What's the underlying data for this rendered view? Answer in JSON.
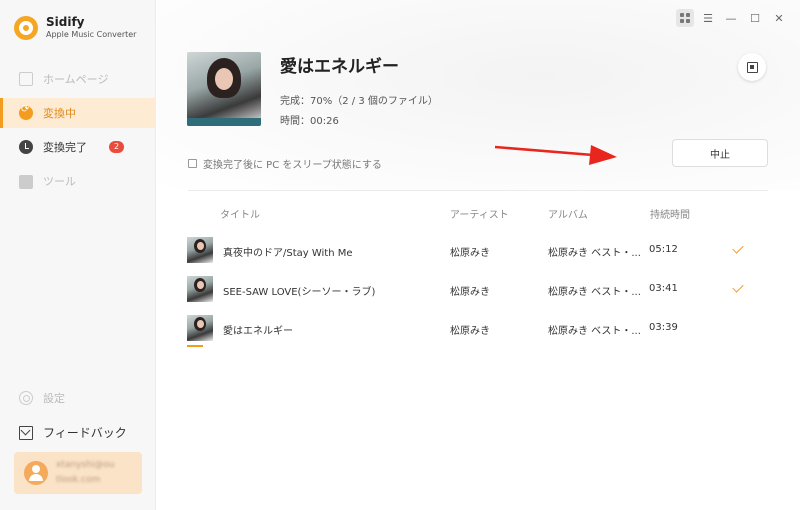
{
  "app": {
    "name": "Sidify",
    "subtitle": "Apple Music Converter"
  },
  "sidebar": {
    "items": [
      {
        "label": "ホームページ",
        "icon": "home-icon"
      },
      {
        "label": "変換中",
        "icon": "converting-icon"
      },
      {
        "label": "変換完了",
        "icon": "check-circle-icon",
        "badge": "2"
      },
      {
        "label": "ツール",
        "icon": "toolbox-icon"
      }
    ],
    "settings_label": "設定",
    "feedback_label": "フィードバック",
    "user_email_line1": "xtanyshi@ou",
    "user_email_line2": "tlook.com"
  },
  "window_controls": {
    "grid": "grid-view-icon",
    "menu": "☰",
    "minimize": "—",
    "maximize": "☐",
    "close": "✕"
  },
  "current": {
    "title": "愛はエネルギー",
    "progress_text": "完成：70%（2 / 3 個のファイル）",
    "progress_percent": 70,
    "time_text": "時間：00:26"
  },
  "sleep_option": {
    "label": "変換完了後に PC をスリープ状態にする",
    "checked": false
  },
  "stop_button": "中止",
  "table": {
    "headers": {
      "title": "タイトル",
      "artist": "アーティスト",
      "album": "アルバム",
      "duration": "持続時間"
    },
    "rows": [
      {
        "title": "真夜中のドア/Stay With Me",
        "artist": "松原みき",
        "album": "松原みき ベスト・...",
        "duration": "05:12",
        "done": true
      },
      {
        "title": "SEE-SAW LOVE(シーソー・ラブ)",
        "artist": "松原みき",
        "album": "松原みき ベスト・...",
        "duration": "03:41",
        "done": true
      },
      {
        "title": "愛はエネルギー",
        "artist": "松原みき",
        "album": "松原みき ベスト・...",
        "duration": "03:39",
        "done": false
      }
    ]
  },
  "colors": {
    "accent": "#f39c1f",
    "badge": "#ea4b3c",
    "arrow": "#e8261e"
  }
}
